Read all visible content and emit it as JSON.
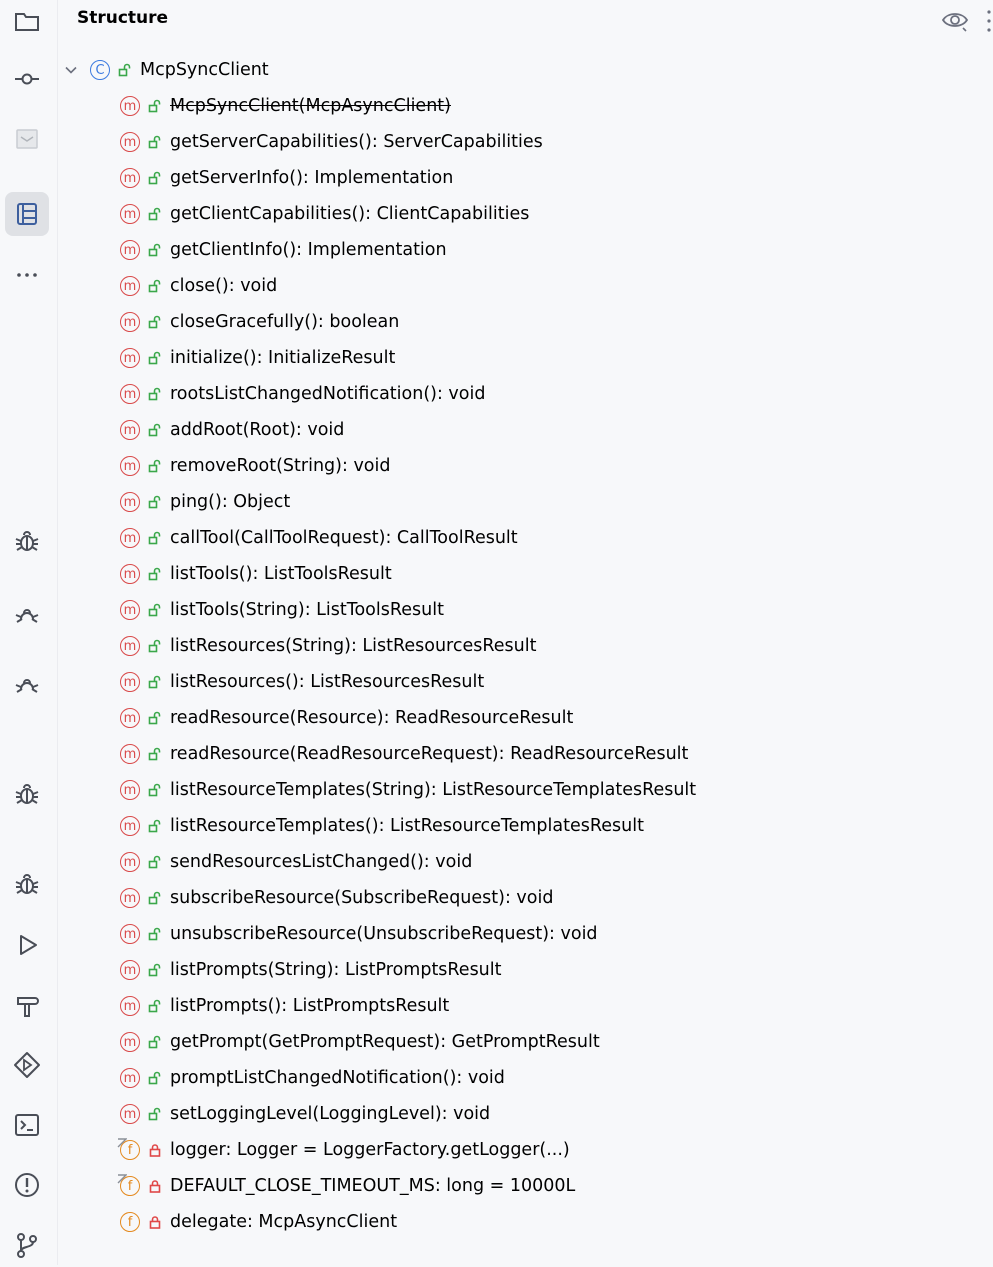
{
  "panel": {
    "title": "Structure",
    "eye_icon": "eye-icon",
    "more_icon": "kebab-icon"
  },
  "sidebar": {
    "items": [
      {
        "icon": "folder-icon"
      },
      {
        "icon": "commit-icon"
      },
      {
        "icon": "image-icon"
      },
      {
        "icon": "structure-icon",
        "active": true
      },
      {
        "icon": "more-horizontal-icon"
      },
      {
        "icon": "bug-icon"
      },
      {
        "icon": "bug-half-icon"
      },
      {
        "icon": "bug-half-icon"
      },
      {
        "icon": "bug-icon"
      },
      {
        "icon": "bug-icon"
      },
      {
        "icon": "run-icon"
      },
      {
        "icon": "hammer-icon"
      },
      {
        "icon": "services-icon"
      },
      {
        "icon": "terminal-icon"
      },
      {
        "icon": "problems-icon"
      },
      {
        "icon": "git-branch-icon"
      }
    ]
  },
  "tree": {
    "root": {
      "label": "McpSyncClient",
      "kind": "C",
      "expanded": true
    },
    "members": [
      {
        "label": "McpSyncClient(McpAsyncClient)",
        "kind": "m",
        "deprecated": true
      },
      {
        "label": "getServerCapabilities(): ServerCapabilities",
        "kind": "m"
      },
      {
        "label": "getServerInfo(): Implementation",
        "kind": "m"
      },
      {
        "label": "getClientCapabilities(): ClientCapabilities",
        "kind": "m"
      },
      {
        "label": "getClientInfo(): Implementation",
        "kind": "m"
      },
      {
        "label": "close(): void",
        "kind": "m"
      },
      {
        "label": "closeGracefully(): boolean",
        "kind": "m"
      },
      {
        "label": "initialize(): InitializeResult",
        "kind": "m"
      },
      {
        "label": "rootsListChangedNotification(): void",
        "kind": "m"
      },
      {
        "label": "addRoot(Root): void",
        "kind": "m"
      },
      {
        "label": "removeRoot(String): void",
        "kind": "m"
      },
      {
        "label": "ping(): Object",
        "kind": "m"
      },
      {
        "label": "callTool(CallToolRequest): CallToolResult",
        "kind": "m"
      },
      {
        "label": "listTools(): ListToolsResult",
        "kind": "m"
      },
      {
        "label": "listTools(String): ListToolsResult",
        "kind": "m"
      },
      {
        "label": "listResources(String): ListResourcesResult",
        "kind": "m"
      },
      {
        "label": "listResources(): ListResourcesResult",
        "kind": "m"
      },
      {
        "label": "readResource(Resource): ReadResourceResult",
        "kind": "m"
      },
      {
        "label": "readResource(ReadResourceRequest): ReadResourceResult",
        "kind": "m"
      },
      {
        "label": "listResourceTemplates(String): ListResourceTemplatesResult",
        "kind": "m"
      },
      {
        "label": "listResourceTemplates(): ListResourceTemplatesResult",
        "kind": "m"
      },
      {
        "label": "sendResourcesListChanged(): void",
        "kind": "m"
      },
      {
        "label": "subscribeResource(SubscribeRequest): void",
        "kind": "m"
      },
      {
        "label": "unsubscribeResource(UnsubscribeRequest): void",
        "kind": "m"
      },
      {
        "label": "listPrompts(String): ListPromptsResult",
        "kind": "m"
      },
      {
        "label": "listPrompts(): ListPromptsResult",
        "kind": "m"
      },
      {
        "label": "getPrompt(GetPromptRequest): GetPromptResult",
        "kind": "m"
      },
      {
        "label": "promptListChangedNotification(): void",
        "kind": "m"
      },
      {
        "label": "setLoggingLevel(LoggingLevel): void",
        "kind": "m"
      },
      {
        "label": "logger: Logger = LoggerFactory.getLogger(...)",
        "kind": "f",
        "static": true,
        "private": true
      },
      {
        "label": "DEFAULT_CLOSE_TIMEOUT_MS: long = 10000L",
        "kind": "f",
        "static": true,
        "private": true
      },
      {
        "label": "delegate: McpAsyncClient",
        "kind": "f",
        "private": true
      }
    ]
  },
  "colors": {
    "method": "#d94b4b",
    "class": "#3b7ae0",
    "field": "#e48a1f",
    "public": "#3aa74a",
    "private": "#e04848"
  }
}
